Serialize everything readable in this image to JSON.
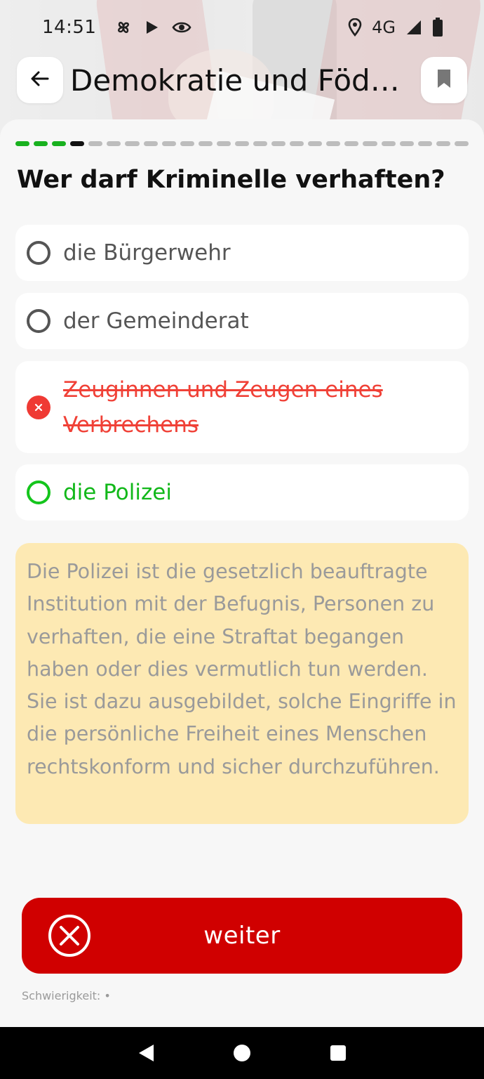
{
  "status_bar": {
    "time": "14:51",
    "network": "4G",
    "left_icons": [
      "pinwheel-icon",
      "play-store-icon",
      "eye-icon"
    ],
    "right_icons": [
      "location-icon",
      "signal-icon",
      "battery-icon"
    ]
  },
  "app_bar": {
    "title": "Demokratie und Föderalismus",
    "back_icon": "arrow-left-icon",
    "bookmark_icon": "bookmark-icon"
  },
  "progress": {
    "total": 25,
    "answered": 3,
    "current_index": 4
  },
  "question": "Wer darf Kriminelle verhaften?",
  "answers": [
    {
      "text": "die Bürgerwehr",
      "state": "neutral"
    },
    {
      "text": "der Gemeinderat",
      "state": "neutral"
    },
    {
      "text": "Zeuginnen und Zeugen eines Verbrechens",
      "state": "wrong"
    },
    {
      "text": "die Polizei",
      "state": "correct"
    }
  ],
  "explanation": "Die Polizei ist die gesetzlich beauftragte Institution mit der Befugnis, Personen zu verhaften, die eine Straftat begangen haben oder dies vermutlich tun werden. Sie ist dazu ausgebildet, solche Eingriffe in die persönliche Freiheit eines Menschen rechtskonform und sicher durchzuführen.",
  "next_button": {
    "label": "weiter",
    "icon": "x-circle-icon"
  },
  "difficulty_label": "Schwierigkeit: •",
  "colors": {
    "correct": "#14c51c",
    "wrong": "#ef3a34",
    "primary": "#d00000",
    "explanation_bg": "#fde9b3"
  },
  "nav_bar": [
    "back-triangle-icon",
    "home-circle-icon",
    "recents-square-icon"
  ]
}
